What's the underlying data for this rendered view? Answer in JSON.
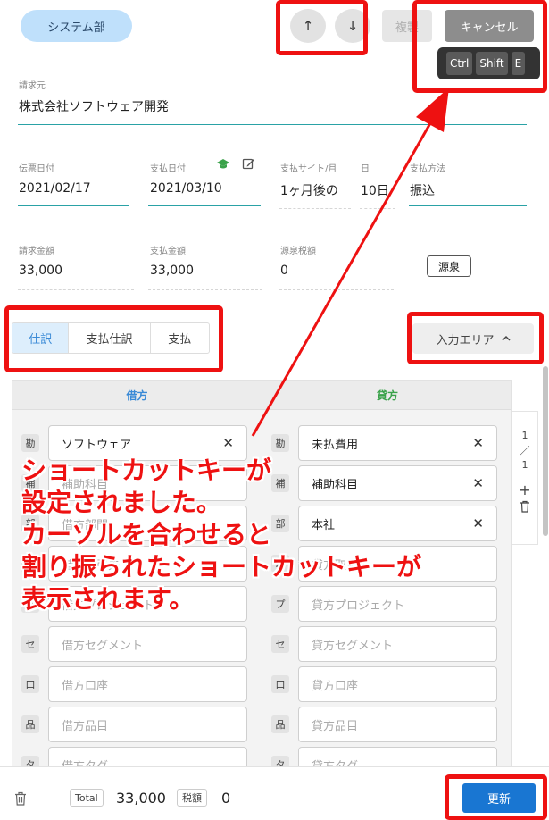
{
  "header": {
    "department": "システム部",
    "up_arrow": "↑",
    "down_arrow": "↓",
    "copy_label": "複製",
    "cancel_label": "キャンセル",
    "shortcut_keys": [
      "Ctrl",
      "Shift",
      "E"
    ]
  },
  "form": {
    "billing_source_label": "請求元",
    "billing_source_value": "株式会社ソフトウェア開発",
    "slip_date_label": "伝票日付",
    "slip_date_value": "2021/02/17",
    "payment_date_label": "支払日付",
    "payment_date_value": "2021/03/10",
    "payment_site_label": "支払サイト/月",
    "payment_site_value": "1ヶ月後の",
    "day_label": "日",
    "day_value": "10日",
    "payment_method_label": "支払方法",
    "payment_method_value": "振込",
    "billed_amount_label": "請求金額",
    "billed_amount_value": "33,000",
    "paid_amount_label": "支払金額",
    "paid_amount_value": "33,000",
    "withholding_label": "源泉税額",
    "withholding_value": "0",
    "gensen_button": "源泉"
  },
  "tabs": [
    "仕訳",
    "支払仕訳",
    "支払"
  ],
  "input_area_button": "入力エリア",
  "journal": {
    "debit_header": "借方",
    "credit_header": "貸方",
    "debit_color": "#3a8ad6",
    "credit_color": "#3aa24a",
    "debit_rows": [
      {
        "tag": "勘",
        "value": "ソフトウェア",
        "filled": true
      },
      {
        "tag": "補",
        "value": "補助科目",
        "filled": false
      },
      {
        "tag": "部",
        "value": "借方部門",
        "filled": false
      },
      {
        "tag": "取",
        "value": "借方取引先",
        "filled": false
      },
      {
        "tag": "プ",
        "value": "借方プロジェクト",
        "filled": false
      },
      {
        "tag": "セ",
        "value": "借方セグメント",
        "filled": false
      },
      {
        "tag": "口",
        "value": "借方口座",
        "filled": false
      },
      {
        "tag": "品",
        "value": "借方品目",
        "filled": false
      },
      {
        "tag": "タ",
        "value": "借方タグ",
        "filled": false
      }
    ],
    "credit_rows": [
      {
        "tag": "勘",
        "value": "未払費用",
        "filled": true
      },
      {
        "tag": "補",
        "value": "補助科目",
        "filled": true
      },
      {
        "tag": "部",
        "value": "本社",
        "filled": true
      },
      {
        "tag": "取",
        "value": "貸方取引先",
        "filled": false
      },
      {
        "tag": "プ",
        "value": "貸方プロジェクト",
        "filled": false
      },
      {
        "tag": "セ",
        "value": "貸方セグメント",
        "filled": false
      },
      {
        "tag": "口",
        "value": "貸方口座",
        "filled": false
      },
      {
        "tag": "品",
        "value": "貸方品目",
        "filled": false
      },
      {
        "tag": "タ",
        "value": "貸方タグ",
        "filled": false
      }
    ],
    "pager_current": "1",
    "pager_sep": "／",
    "pager_total": "1",
    "add_symbol": "+"
  },
  "footer": {
    "total_label": "Total",
    "total_value": "33,000",
    "tax_label": "税額",
    "tax_value": "0",
    "update_label": "更新"
  },
  "annotation": {
    "color": "#ee1111",
    "text": "ショートカットキーが\n設定されました。\nカーソルを合わせると\n割り振られたショートカットキーが\n表示されます。"
  }
}
